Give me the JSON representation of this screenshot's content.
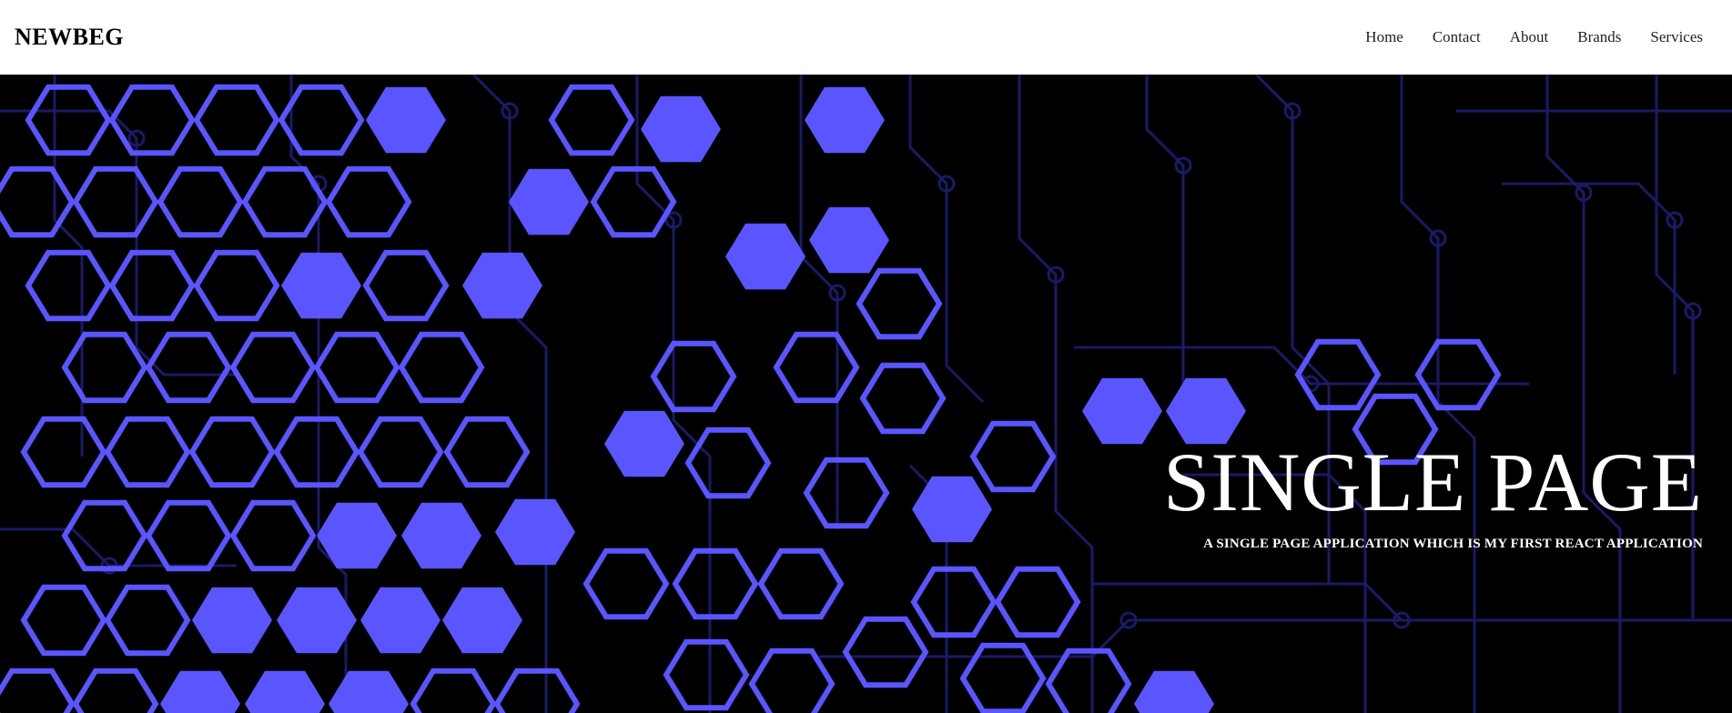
{
  "nav": {
    "brand": "NEWBEG",
    "links": [
      {
        "label": "Home"
      },
      {
        "label": "Contact"
      },
      {
        "label": "About"
      },
      {
        "label": "Brands"
      },
      {
        "label": "Services"
      }
    ]
  },
  "hero": {
    "title": "SINGLE PAGE",
    "subtitle": "A SINGLE PAGE APPLICATION WHICH IS MY FIRST REACT APPLICATION",
    "background_image": "circuit-hexagon-pattern",
    "colors": {
      "background": "#000000",
      "hexagon": "#5a55ff",
      "circuit": "#1a1a66"
    }
  }
}
